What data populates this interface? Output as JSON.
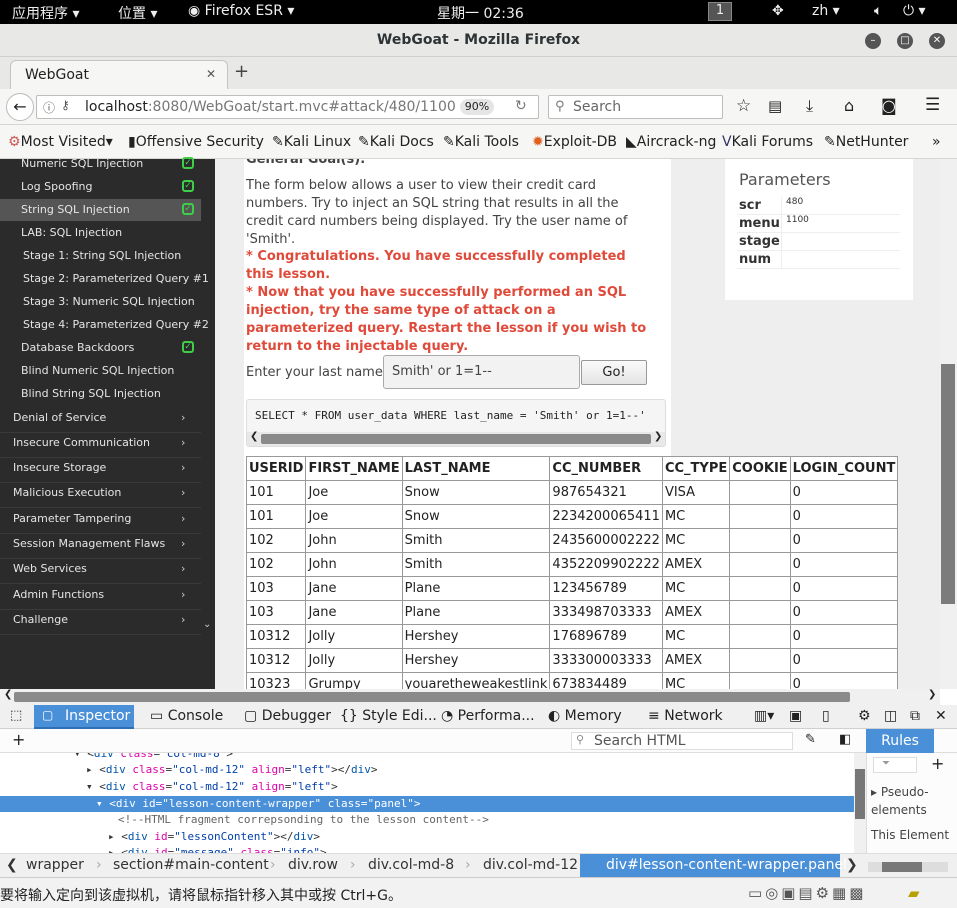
{
  "topbar": {
    "apps": "应用程序",
    "places": "位置",
    "browser": "Firefox ESR",
    "clock": "星期一 02:36",
    "workspace": "1",
    "lang": "zh"
  },
  "window": {
    "title": "WebGoat - Mozilla Firefox"
  },
  "tab": {
    "label": "WebGoat",
    "new_tab": "+"
  },
  "nav": {
    "url_host": "localhost",
    "url_rest": ":8080/WebGoat/start.mvc#attack/480/1100",
    "zoom": "90%",
    "search_placeholder": "Search"
  },
  "bookmarks": [
    "Most Visited",
    "Offensive Security",
    "Kali Linux",
    "Kali Docs",
    "Kali Tools",
    "Exploit-DB",
    "Aircrack-ng",
    "Kali Forums",
    "NetHunter"
  ],
  "sidebar": {
    "lessons": [
      {
        "label": "Numeric SQL Injection",
        "done": true
      },
      {
        "label": "Log Spoofing",
        "done": true
      },
      {
        "label": "String SQL Injection",
        "done": true,
        "active": true
      },
      {
        "label": "LAB: SQL Injection",
        "done": false
      },
      {
        "label": "Stage 1: String SQL Injection",
        "done": false
      },
      {
        "label": "Stage 2: Parameterized Query #1",
        "done": false
      },
      {
        "label": "Stage 3: Numeric SQL Injection",
        "done": false
      },
      {
        "label": "Stage 4: Parameterized Query #2",
        "done": false
      },
      {
        "label": "Database Backdoors",
        "done": true
      },
      {
        "label": "Blind Numeric SQL Injection",
        "done": false
      },
      {
        "label": "Blind String SQL Injection",
        "done": false
      }
    ],
    "categories": [
      "Denial of Service",
      "Insecure Communication",
      "Insecure Storage",
      "Malicious Execution",
      "Parameter Tampering",
      "Session Management Flaws",
      "Web Services",
      "Admin Functions",
      "Challenge"
    ]
  },
  "lesson": {
    "heading": "General Goal(s):",
    "intro": "The form below allows a user to view their credit card numbers. Try to inject an SQL string that results in all the credit card numbers being displayed. Try the user name of 'Smith'.",
    "congrats": "* Congratulations. You have successfully completed this lesson.",
    "next": "* Now that you have successfully performed an SQL injection, try the same type of attack on a parameterized query. Restart the lesson if you wish to return to the injectable query.",
    "input_label": "Enter your last name:",
    "input_value": "Smith' or 1=1--",
    "go": "Go!",
    "query": "SELECT * FROM user_data WHERE last_name = 'Smith' or 1=1--'"
  },
  "results": {
    "headers": [
      "USERID",
      "FIRST_NAME",
      "LAST_NAME",
      "CC_NUMBER",
      "CC_TYPE",
      "COOKIE",
      "LOGIN_COUNT"
    ],
    "rows": [
      [
        "101",
        "Joe",
        "Snow",
        "987654321",
        "VISA",
        "",
        "0"
      ],
      [
        "101",
        "Joe",
        "Snow",
        "2234200065411",
        "MC",
        "",
        "0"
      ],
      [
        "102",
        "John",
        "Smith",
        "2435600002222",
        "MC",
        "",
        "0"
      ],
      [
        "102",
        "John",
        "Smith",
        "4352209902222",
        "AMEX",
        "",
        "0"
      ],
      [
        "103",
        "Jane",
        "Plane",
        "123456789",
        "MC",
        "",
        "0"
      ],
      [
        "103",
        "Jane",
        "Plane",
        "333498703333",
        "AMEX",
        "",
        "0"
      ],
      [
        "10312",
        "Jolly",
        "Hershey",
        "176896789",
        "MC",
        "",
        "0"
      ],
      [
        "10312",
        "Jolly",
        "Hershey",
        "333300003333",
        "AMEX",
        "",
        "0"
      ],
      [
        "10323",
        "Grumpy",
        "youaretheweakestlink",
        "673834489",
        "MC",
        "",
        "0"
      ]
    ]
  },
  "params": {
    "title": "Parameters",
    "rows": [
      [
        "scr",
        "480"
      ],
      [
        "menu",
        "1100"
      ],
      [
        "stage",
        ""
      ],
      [
        "num",
        ""
      ]
    ]
  },
  "devtools": {
    "tabs": [
      "Inspector",
      "Console",
      "Debugger",
      "Style Edi...",
      "Performa...",
      "Memory",
      "Network"
    ],
    "search_placeholder": "Search HTML",
    "rules": "Rules",
    "pseudo": "Pseudo-elements",
    "this_element": "This Element",
    "crumbs": [
      "wrapper",
      "section#main-content",
      "div.row",
      "div.col-md-8",
      "div.col-md-12",
      "div#lesson-content-wrapper.panel"
    ],
    "comment": "<!--HTML fragment correpsonding to the lesson content-->"
  },
  "status": {
    "message": "要将输入定向到该虚拟机，请将鼠标指针移入其中或按 Ctrl+G。"
  }
}
